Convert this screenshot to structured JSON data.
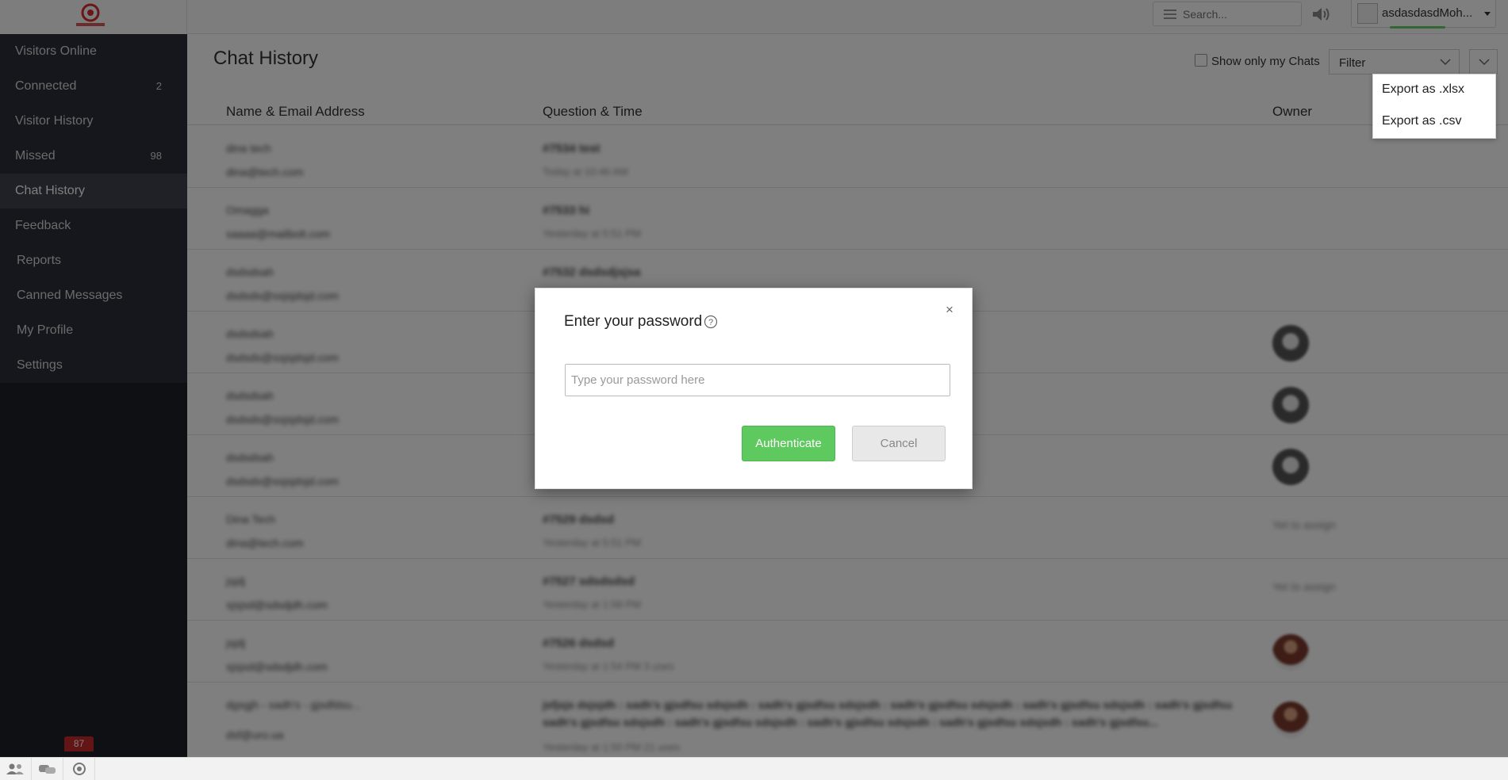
{
  "topbar": {
    "search_placeholder": "Search...",
    "user_name": "asdasdasdMoh...",
    "status_color": "#66cc66"
  },
  "sidebar": {
    "items": [
      {
        "label": "Visitors Online",
        "count": ""
      },
      {
        "label": "Connected",
        "count": "2"
      },
      {
        "label": "Visitor History",
        "count": ""
      },
      {
        "label": "Missed",
        "count": "98"
      },
      {
        "label": "Chat History",
        "count": "",
        "active": true
      },
      {
        "label": "Feedback",
        "count": ""
      },
      {
        "label": "Reports",
        "count": ""
      },
      {
        "label": "Canned Messages",
        "count": ""
      },
      {
        "label": "My Profile",
        "count": ""
      },
      {
        "label": "Settings",
        "count": ""
      }
    ]
  },
  "bottombar": {
    "icons": [
      "users-icon",
      "chats-icon",
      "support-icon"
    ],
    "badge": "87"
  },
  "main": {
    "title": "Chat History",
    "show_only_mine_label": "Show only my Chats",
    "filter_label": "Filter",
    "columns": [
      "Name & Email Address",
      "Question & Time",
      "Owner"
    ],
    "rows": [
      {
        "name": "dina tech",
        "email": "dina@tech.com",
        "question": "#7534  test",
        "time": "Today at 10:46 AM",
        "owner": ""
      },
      {
        "name": "Omagga",
        "email": "saaaa@mailbolt.com",
        "question": "#7533  hi",
        "time": "Yesterday at 5:51 PM",
        "owner": ""
      },
      {
        "name": "dsdsdsah",
        "email": "dsdsds@ssjsjdsjd.com",
        "question": "#7532  dsdsdjsjsa",
        "time": "",
        "owner": ""
      },
      {
        "name": "dsdsdsah",
        "email": "dsdsds@ssjsjdsjd.com",
        "question": "",
        "time": "",
        "owner": "avatar"
      },
      {
        "name": "dsdsdsah",
        "email": "dsdsds@ssjsjdsjd.com",
        "question": "",
        "time": "",
        "owner": "avatar"
      },
      {
        "name": "dsdsdsah",
        "email": "dsdsds@ssjsjdsjd.com",
        "question": "",
        "time": "",
        "owner": "avatar"
      },
      {
        "name": "Dina Tech",
        "email": "dina@tech.com",
        "question": "#7529  dsdsd",
        "time": "Yesterday at 5:51 PM",
        "owner": "Yet to assign"
      },
      {
        "name": "jsjdj",
        "email": "sjsjsd@sdsdjdh.com",
        "question": "#7527  sdsdsdsd",
        "time": "Yesterday at 1:58 PM",
        "owner": "Yet to assign"
      },
      {
        "name": "jsjdj",
        "email": "sjsjsd@sdsdjdh.com",
        "question": "#7526  dsdsd",
        "time": "Yesterday at 1:54 PM  3 uses",
        "owner": "person"
      },
      {
        "name": "dgsgjh - sadh's - gjsdfdsu...",
        "email": "dsf@uro.ua",
        "question": "jsfjsjs dsjsjdh : sadh's gjsdfsu sdsjsdh : sadh's gjsdfsu sdsjsdh : sadh's gjsdfsu sdsjsdh : sadh's gjsdfsu sdsjsdh : sadh's gjsdfsu",
        "question2": "sadh's gjsdfsu sdsjsdh : sadh's gjsdfsu sdsjsdh : sadh's gjsdfsu sdsjsdh : sadh's gjsdfsu sdsjsdh : sadh's gjsdfsu...",
        "time": "Yesterday at 1:50 PM  21 uses",
        "owner": "person"
      }
    ]
  },
  "export_menu": {
    "items": [
      "Export as .xlsx",
      "Export as .csv"
    ]
  },
  "modal": {
    "title": "Enter your password",
    "input_placeholder": "Type your password here",
    "authenticate_label": "Authenticate",
    "cancel_label": "Cancel",
    "close_glyph": "×",
    "authenticate_color": "#5ec95e"
  }
}
